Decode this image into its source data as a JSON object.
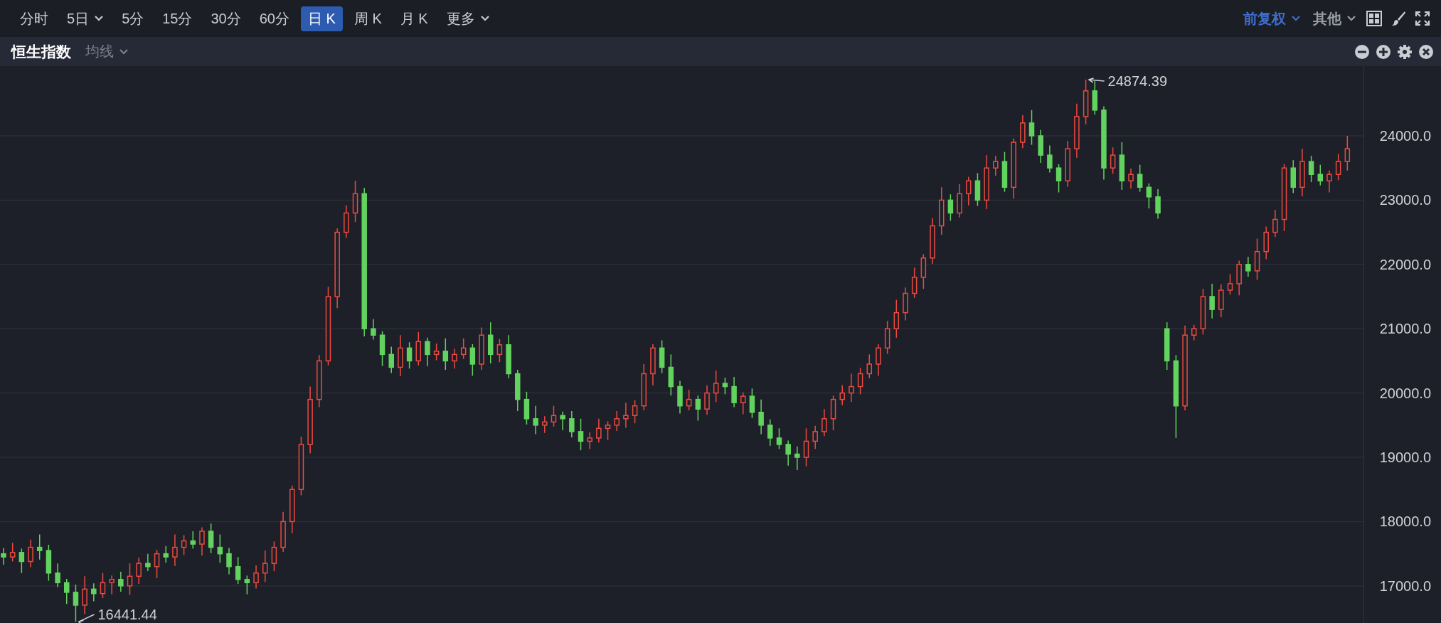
{
  "toolbar": {
    "periods": [
      {
        "label": "分时",
        "selected": false,
        "dropdown": false
      },
      {
        "label": "5日",
        "selected": false,
        "dropdown": true
      },
      {
        "label": "5分",
        "selected": false,
        "dropdown": false
      },
      {
        "label": "15分",
        "selected": false,
        "dropdown": false
      },
      {
        "label": "30分",
        "selected": false,
        "dropdown": false
      },
      {
        "label": "60分",
        "selected": false,
        "dropdown": false
      },
      {
        "label": "日 K",
        "selected": true,
        "dropdown": false
      },
      {
        "label": "周 K",
        "selected": false,
        "dropdown": false
      },
      {
        "label": "月 K",
        "selected": false,
        "dropdown": false
      },
      {
        "label": "更多",
        "selected": false,
        "dropdown": true
      }
    ],
    "options": [
      {
        "label": "前复权",
        "selected": true
      },
      {
        "label": "其他",
        "selected": false
      }
    ]
  },
  "indicator_bar": {
    "title": "恒生指数",
    "overlay": "均线"
  },
  "chart": {
    "chart_data": {
      "type": "candlestick",
      "grid": true,
      "ylim": [
        16423,
        25084
      ],
      "yticks": [
        {
          "value": 24000,
          "label": "24000.0"
        },
        {
          "value": 23000,
          "label": "23000.0"
        },
        {
          "value": 22000,
          "label": "22000.0"
        },
        {
          "value": 21000,
          "label": "21000.0"
        },
        {
          "value": 20000,
          "label": "20000.0"
        },
        {
          "value": 19000,
          "label": "19000.0"
        },
        {
          "value": 18000,
          "label": "18000.0"
        },
        {
          "value": 17000,
          "label": "17000.0"
        }
      ],
      "annotations": [
        "24874.39",
        "16441.44"
      ],
      "ohlc": [
        [
          17500,
          17590,
          17330,
          17450
        ],
        [
          17450,
          17670,
          17380,
          17520
        ],
        [
          17520,
          17580,
          17200,
          17380
        ],
        [
          17380,
          17720,
          17290,
          17600
        ],
        [
          17600,
          17800,
          17410,
          17550
        ],
        [
          17550,
          17640,
          17080,
          17200
        ],
        [
          17200,
          17350,
          16980,
          17050
        ],
        [
          17050,
          17110,
          16720,
          16900
        ],
        [
          16900,
          17020,
          16441.44,
          16700
        ],
        [
          16700,
          17150,
          16560,
          16950
        ],
        [
          16950,
          17040,
          16760,
          16880
        ],
        [
          16880,
          17200,
          16810,
          17050
        ],
        [
          17050,
          17160,
          16870,
          17100
        ],
        [
          17100,
          17220,
          16910,
          17000
        ],
        [
          17000,
          17350,
          16860,
          17150
        ],
        [
          17150,
          17440,
          17030,
          17350
        ],
        [
          17350,
          17500,
          17230,
          17300
        ],
        [
          17300,
          17560,
          17120,
          17500
        ],
        [
          17500,
          17620,
          17360,
          17450
        ],
        [
          17450,
          17800,
          17310,
          17600
        ],
        [
          17600,
          17790,
          17480,
          17700
        ],
        [
          17700,
          17850,
          17580,
          17650
        ],
        [
          17650,
          17910,
          17470,
          17850
        ],
        [
          17850,
          17970,
          17510,
          17600
        ],
        [
          17600,
          17800,
          17360,
          17500
        ],
        [
          17500,
          17590,
          17180,
          17300
        ],
        [
          17300,
          17450,
          17030,
          17100
        ],
        [
          17100,
          17160,
          16870,
          17050
        ],
        [
          17050,
          17320,
          16960,
          17200
        ],
        [
          17200,
          17550,
          17060,
          17350
        ],
        [
          17350,
          17690,
          17230,
          17600
        ],
        [
          17600,
          18150,
          17530,
          18000
        ],
        [
          18000,
          18560,
          17820,
          18500
        ],
        [
          18500,
          19320,
          18410,
          19200
        ],
        [
          19200,
          20100,
          19060,
          19900
        ],
        [
          19900,
          20590,
          19780,
          20500
        ],
        [
          20500,
          21650,
          20430,
          21500
        ],
        [
          21500,
          22560,
          21320,
          22500
        ],
        [
          22500,
          22920,
          22410,
          22800
        ],
        [
          22800,
          23300,
          22660,
          23100
        ],
        [
          23100,
          23190,
          20880,
          21000
        ],
        [
          21000,
          21150,
          20830,
          20900
        ],
        [
          20900,
          20960,
          20420,
          20600
        ],
        [
          20600,
          20720,
          20310,
          20400
        ],
        [
          20400,
          20900,
          20260,
          20700
        ],
        [
          20700,
          20790,
          20380,
          20500
        ],
        [
          20500,
          20950,
          20430,
          20800
        ],
        [
          20800,
          20860,
          20420,
          20600
        ],
        [
          20600,
          20770,
          20510,
          20650
        ],
        [
          20650,
          20850,
          20360,
          20500
        ],
        [
          20500,
          20690,
          20380,
          20600
        ],
        [
          20600,
          20850,
          20530,
          20700
        ],
        [
          20700,
          20760,
          20270,
          20450
        ],
        [
          20450,
          21020,
          20360,
          20900
        ],
        [
          20900,
          21100,
          20460,
          20600
        ],
        [
          20600,
          20840,
          20480,
          20750
        ],
        [
          20750,
          20900,
          20230,
          20300
        ],
        [
          20300,
          20360,
          19720,
          19900
        ],
        [
          19900,
          20020,
          19510,
          19600
        ],
        [
          19600,
          19800,
          19360,
          19500
        ],
        [
          19500,
          19640,
          19380,
          19550
        ],
        [
          19550,
          19800,
          19480,
          19650
        ],
        [
          19650,
          19710,
          19420,
          19600
        ],
        [
          19600,
          19720,
          19310,
          19400
        ],
        [
          19400,
          19600,
          19110,
          19250
        ],
        [
          19250,
          19390,
          19130,
          19300
        ],
        [
          19300,
          19600,
          19230,
          19450
        ],
        [
          19450,
          19560,
          19270,
          19500
        ],
        [
          19500,
          19720,
          19410,
          19600
        ],
        [
          19600,
          19850,
          19460,
          19650
        ],
        [
          19650,
          19890,
          19530,
          19800
        ],
        [
          19800,
          20450,
          19730,
          20300
        ],
        [
          20300,
          20760,
          20120,
          20700
        ],
        [
          20700,
          20820,
          20310,
          20400
        ],
        [
          20400,
          20600,
          19960,
          20100
        ],
        [
          20100,
          20190,
          19680,
          19800
        ],
        [
          19800,
          20050,
          19730,
          19900
        ],
        [
          19900,
          19960,
          19570,
          19750
        ],
        [
          19750,
          20120,
          19660,
          20000
        ],
        [
          20000,
          20350,
          19860,
          20150
        ],
        [
          20150,
          20240,
          19980,
          20100
        ],
        [
          20100,
          20250,
          19780,
          19850
        ],
        [
          19850,
          20010,
          19670,
          19950
        ],
        [
          19950,
          20070,
          19610,
          19700
        ],
        [
          19700,
          19900,
          19360,
          19500
        ],
        [
          19500,
          19590,
          19180,
          19300
        ],
        [
          19300,
          19450,
          19130,
          19200
        ],
        [
          19200,
          19260,
          18870,
          19050
        ],
        [
          19050,
          19170,
          18800,
          19000
        ],
        [
          19000,
          19450,
          18860,
          19250
        ],
        [
          19250,
          19490,
          19130,
          19400
        ],
        [
          19400,
          19750,
          19330,
          19600
        ],
        [
          19600,
          19960,
          19420,
          19900
        ],
        [
          19900,
          20120,
          19810,
          20000
        ],
        [
          20000,
          20300,
          19860,
          20100
        ],
        [
          20100,
          20390,
          19980,
          20300
        ],
        [
          20300,
          20600,
          20230,
          20450
        ],
        [
          20450,
          20760,
          20270,
          20700
        ],
        [
          20700,
          21120,
          20610,
          21000
        ],
        [
          21000,
          21450,
          20860,
          21250
        ],
        [
          21250,
          21640,
          21130,
          21550
        ],
        [
          21550,
          21950,
          21480,
          21800
        ],
        [
          21800,
          22160,
          21620,
          22100
        ],
        [
          22100,
          22720,
          22010,
          22600
        ],
        [
          22600,
          23200,
          22460,
          23000
        ],
        [
          23000,
          23090,
          22680,
          22800
        ],
        [
          22800,
          23250,
          22730,
          23100
        ],
        [
          23100,
          23360,
          22920,
          23300
        ],
        [
          23300,
          23420,
          22910,
          23000
        ],
        [
          23000,
          23700,
          22860,
          23500
        ],
        [
          23500,
          23690,
          23380,
          23600
        ],
        [
          23600,
          23750,
          23130,
          23200
        ],
        [
          23200,
          23960,
          23020,
          23900
        ],
        [
          23900,
          24320,
          23810,
          24200
        ],
        [
          24200,
          24400,
          23860,
          24000
        ],
        [
          24000,
          24090,
          23580,
          23700
        ],
        [
          23700,
          23850,
          23430,
          23500
        ],
        [
          23500,
          23560,
          23120,
          23300
        ],
        [
          23300,
          23920,
          23210,
          23800
        ],
        [
          23800,
          24500,
          23660,
          24300
        ],
        [
          24300,
          24874.39,
          24180,
          24700
        ],
        [
          24700,
          24850,
          24330,
          24400
        ],
        [
          24400,
          24460,
          23320,
          23500
        ],
        [
          23500,
          23820,
          23410,
          23700
        ],
        [
          23700,
          23900,
          23160,
          23300
        ],
        [
          23300,
          23490,
          23180,
          23400
        ],
        [
          23400,
          23550,
          23130,
          23200
        ],
        [
          23200,
          23260,
          22870,
          23050
        ],
        [
          23050,
          23170,
          22710,
          22800
        ],
        [
          21000,
          21100,
          20360,
          20500
        ],
        [
          20500,
          20590,
          19300,
          19800
        ],
        [
          19800,
          21050,
          19730,
          20900
        ],
        [
          20900,
          21060,
          20820,
          21000
        ],
        [
          21000,
          21620,
          20910,
          21500
        ],
        [
          21500,
          21700,
          21160,
          21300
        ],
        [
          21300,
          21690,
          21180,
          21600
        ],
        [
          21600,
          21850,
          21530,
          21700
        ],
        [
          21700,
          22060,
          21520,
          22000
        ],
        [
          22000,
          22120,
          21810,
          21900
        ],
        [
          21900,
          22400,
          21760,
          22200
        ],
        [
          22200,
          22590,
          22080,
          22500
        ],
        [
          22500,
          22850,
          22430,
          22700
        ],
        [
          22700,
          23560,
          22520,
          23500
        ],
        [
          23500,
          23620,
          23110,
          23200
        ],
        [
          23200,
          23800,
          23060,
          23600
        ],
        [
          23600,
          23690,
          23280,
          23400
        ],
        [
          23400,
          23550,
          23230,
          23300
        ],
        [
          23300,
          23460,
          23120,
          23400
        ],
        [
          23400,
          23720,
          23310,
          23600
        ],
        [
          23600,
          24000,
          23460,
          23800
        ]
      ]
    }
  }
}
